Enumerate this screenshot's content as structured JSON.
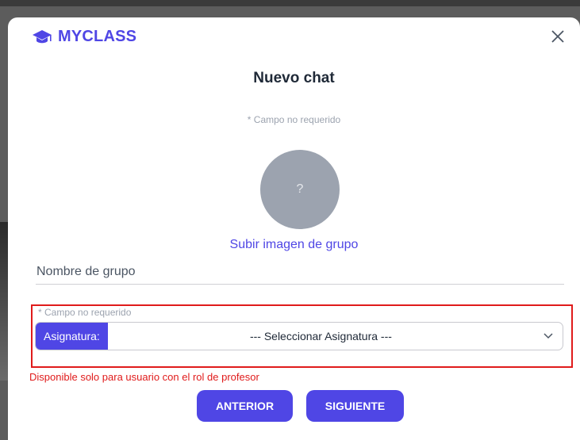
{
  "brand": {
    "name": "MYCLASS",
    "icon": "graduation-cap-icon",
    "color": "#4f46e5"
  },
  "modal": {
    "title": "Nuevo chat",
    "optional_note": "* Campo no requerido",
    "avatar_placeholder": "?",
    "upload_link": "Subir imagen de grupo",
    "group_name": {
      "placeholder": "Nombre de grupo",
      "value": ""
    },
    "subject_optional_note": "* Campo no requerido",
    "subject_select": {
      "label": "Asignatura:",
      "selected": "--- Seleccionar Asignatura ---"
    },
    "teacher_only_note": "Disponible solo para usuario con el rol de profesor",
    "buttons": {
      "previous": "ANTERIOR",
      "next": "SIGUIENTE"
    }
  },
  "colors": {
    "accent": "#4f46e5",
    "error": "#e01b1b",
    "muted": "#9ca3af"
  }
}
